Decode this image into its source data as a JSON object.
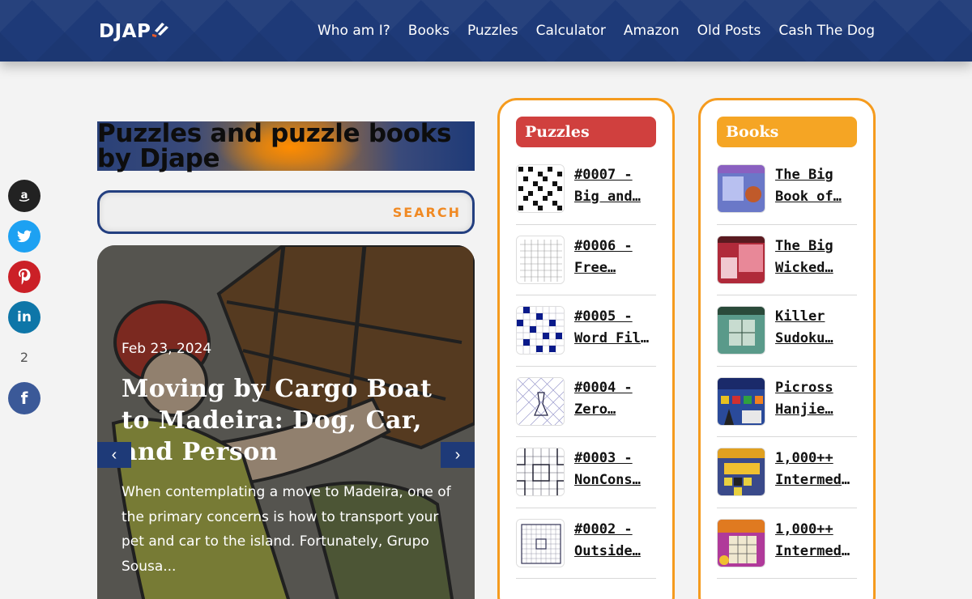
{
  "header": {
    "logo_text": "DJAP",
    "nav": [
      "Who am I?",
      "Books",
      "Puzzles",
      "Calculator",
      "Amazon",
      "Old Posts",
      "Cash The Dog"
    ]
  },
  "social": {
    "buttons": [
      {
        "name": "amazon",
        "glyph": "a",
        "color": "#222222"
      },
      {
        "name": "twitter",
        "glyph": "t",
        "color": "#1da1f2"
      },
      {
        "name": "pinterest",
        "glyph": "p",
        "color": "#cb2027"
      },
      {
        "name": "linkedin",
        "glyph": "in",
        "color": "#0e76a8"
      }
    ],
    "share_count": "2",
    "facebook": {
      "glyph": "f",
      "color": "#3b5998"
    }
  },
  "page": {
    "title_line1": "Puzzles and puzzle books",
    "title_line2": "by Djape"
  },
  "search": {
    "placeholder": "",
    "button_label": "SEARCH"
  },
  "slide": {
    "date": "Feb 23, 2024",
    "title": "Moving by Cargo Boat to Madeira: Dog, Car, and Person",
    "excerpt": "When contemplating a move to Madeira, one of the primary concerns is how to transport your pet and car to the island. Fortunately, Grupo Sousa...",
    "prev": "‹",
    "next": "›"
  },
  "puzzles": {
    "heading": "Puzzles",
    "items": [
      {
        "line1": "#0007 -",
        "line2": "Big and…"
      },
      {
        "line1": "#0006 -",
        "line2": "Free…"
      },
      {
        "line1": "#0005 -",
        "line2": "Word Fill-…"
      },
      {
        "line1": "#0004 -",
        "line2": "Zero…"
      },
      {
        "line1": "#0003 -",
        "line2": "NonCons…"
      },
      {
        "line1": "#0002 -",
        "line2": "Outside…"
      }
    ]
  },
  "books": {
    "heading": "Books",
    "items": [
      {
        "line1": "The Big",
        "line2": "Book of…"
      },
      {
        "line1": "The Big",
        "line2": "Wicked…"
      },
      {
        "line1": "Killer",
        "line2": "Sudoku…"
      },
      {
        "line1": "Picross",
        "line2": "Hanjie…"
      },
      {
        "line1": "1,000++",
        "line2": "Intermedia…"
      },
      {
        "line1": "1,000++",
        "line2": "Intermedia…"
      }
    ]
  }
}
